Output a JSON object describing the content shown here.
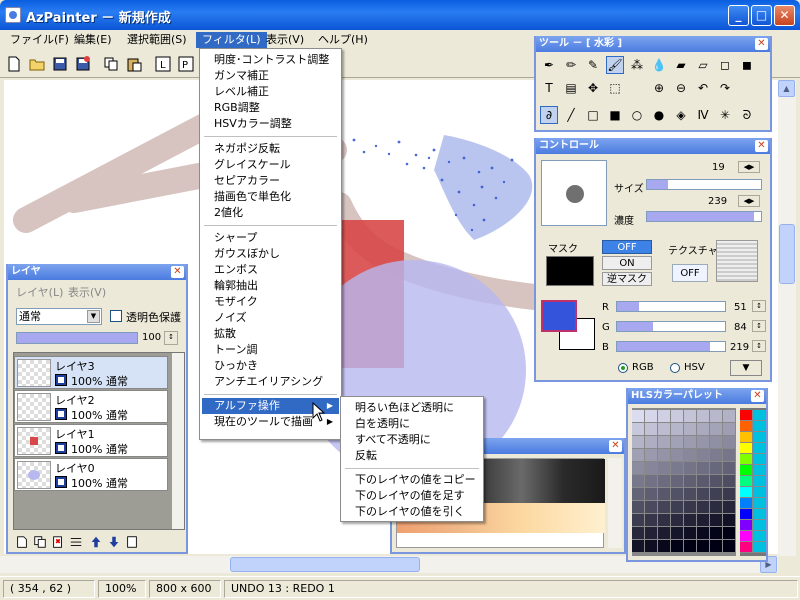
{
  "app": {
    "title": "AzPainter － 新規作成"
  },
  "menubar": [
    "ファイル(F)",
    "編集(E)",
    "選択範囲(S)",
    "フィルタ(L)",
    "表示(V)",
    "ヘルプ(H)"
  ],
  "filter_menu": {
    "g1": [
      "明度･コントラスト調整",
      "ガンマ補正",
      "レベル補正",
      "RGB調整",
      "HSVカラー調整"
    ],
    "g2": [
      "ネガポジ反転",
      "グレイスケール",
      "セピアカラー",
      "描画色で単色化",
      "2値化"
    ],
    "g3": [
      "シャープ",
      "ガウスぼかし",
      "エンボス",
      "輪郭抽出",
      "モザイク",
      "ノイズ",
      "拡散",
      "トーン調",
      "ひっかき",
      "アンチエイリアシング"
    ],
    "g4": [
      "アルファ操作",
      "現在のツールで描画"
    ]
  },
  "alpha_menu": {
    "g1": [
      "明るい色ほど透明に",
      "白を透明に",
      "すべて不透明に",
      "反転"
    ],
    "g2": [
      "下のレイヤの値をコピー",
      "下のレイヤの値を足す",
      "下のレイヤの値を引く"
    ]
  },
  "tool_panel": {
    "title": "ツール － [ 水彩 ]",
    "icons": [
      "pen-icon",
      "pencil-icon",
      "brush-icon",
      "watercolor-icon",
      "spray-icon",
      "blur-icon",
      "eraser-icon",
      "eraser2-icon",
      "dodge-icon",
      "burn-icon",
      "text-icon",
      "gradient-icon",
      "move-icon",
      "select-icon",
      "zoom-in-icon",
      "zoom-out-icon",
      "undo-icon",
      "redo-icon",
      "freehand-icon",
      "line-icon",
      "rect-icon",
      "fillrect-icon",
      "ellipse-icon",
      "fillellipse-icon",
      "fill-icon",
      "polyline-icon",
      "star-icon",
      "curve-icon"
    ]
  },
  "control_panel": {
    "title": "コントロール",
    "size_label": "サイズ",
    "size_value": "19",
    "density_label": "濃度",
    "density_value": "239",
    "size_fill": 0.18,
    "density_fill": 0.94,
    "mask_label": "マスク",
    "mask_options": [
      "OFF",
      "ON",
      "逆マスク"
    ],
    "texture_label": "テクスチャ",
    "texture_value": "OFF",
    "r_label": "R",
    "r_value": "51",
    "g_label": "G",
    "g_value": "84",
    "b_label": "B",
    "b_value": "219",
    "r_fill": 0.2,
    "g_fill": 0.33,
    "b_fill": 0.86,
    "mode_rgb": "RGB",
    "mode_hsv": "HSV",
    "fg_color": "#3354db"
  },
  "hls_panel": {
    "title": "HLSカラーパレット"
  },
  "layer_panel": {
    "title": "レイヤ",
    "menu": [
      "レイヤ(L)",
      "表示(V)"
    ],
    "blend": "通常",
    "keep_alpha_label": "透明色保護",
    "opacity": "100",
    "layers": [
      {
        "name": "レイヤ3",
        "info": "100% 通常"
      },
      {
        "name": "レイヤ2",
        "info": "100% 通常"
      },
      {
        "name": "レイヤ1",
        "info": "100% 通常"
      },
      {
        "name": "レイヤ0",
        "info": "100% 通常"
      }
    ]
  },
  "status": {
    "coords": "( 354 ,  62 )",
    "zoom": "100%",
    "size": "800 x 600",
    "undo": "UNDO 13 : REDO  1"
  }
}
